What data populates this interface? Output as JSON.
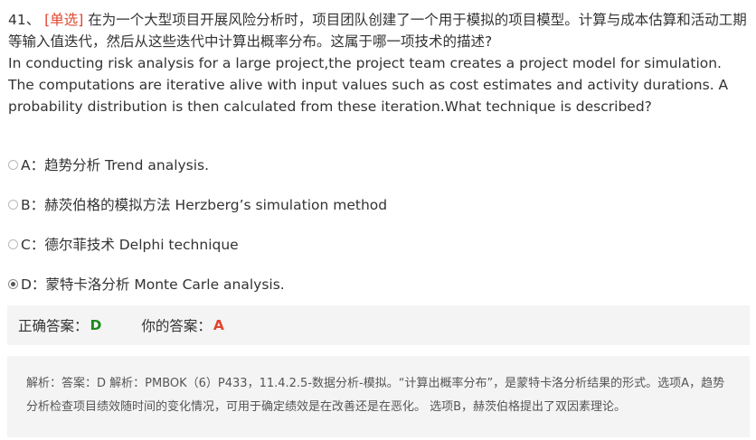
{
  "question": {
    "number": "41、",
    "type": "[单选]",
    "text_cn": "在为一个大型项目开展风险分析时，项目团队创建了一个用于模拟的项目模型。计算与成本估算和活动工期等输入值迭代，然后从这些迭代中计算出概率分布。这属于哪一项技术的描述?",
    "text_en": "In conducting risk analysis for a large project,the project team creates a project model for simulation. The computations are iterative alive with input values such as cost estimates and activity durations. A probability distribution is then calculated from these iteration.What technique is described?"
  },
  "options": [
    {
      "key": "A",
      "label": "A：趋势分析 Trend analysis.",
      "selected": false
    },
    {
      "key": "B",
      "label": "B：赫茨伯格的模拟方法 Herzberg’s simulation method",
      "selected": false
    },
    {
      "key": "C",
      "label": "C：德尔菲技术 Delphi technique",
      "selected": false
    },
    {
      "key": "D",
      "label": "D：蒙特卡洛分析 Monte Carle analysis.",
      "selected": true
    }
  ],
  "answer": {
    "correct_label": "正确答案：",
    "correct_value": "D",
    "yours_label": "你的答案：",
    "yours_value": "A"
  },
  "analysis": {
    "text": "解析：答案：D 解析：PMBOK（6）P433，11.4.2.5-数据分析-模拟。“计算出概率分布”，是蒙特卡洛分析结果的形式。选项A，趋势分析检查项目绩效随时间的变化情况，可用于确定绩效是在改善还是在恶化。 选项B，赫茨伯格提出了双因素理论。"
  },
  "colors": {
    "type_tag": "#e0452e",
    "correct": "#1a8a1a",
    "wrong": "#e0452e",
    "panel_bg": "#f4f4f4"
  }
}
